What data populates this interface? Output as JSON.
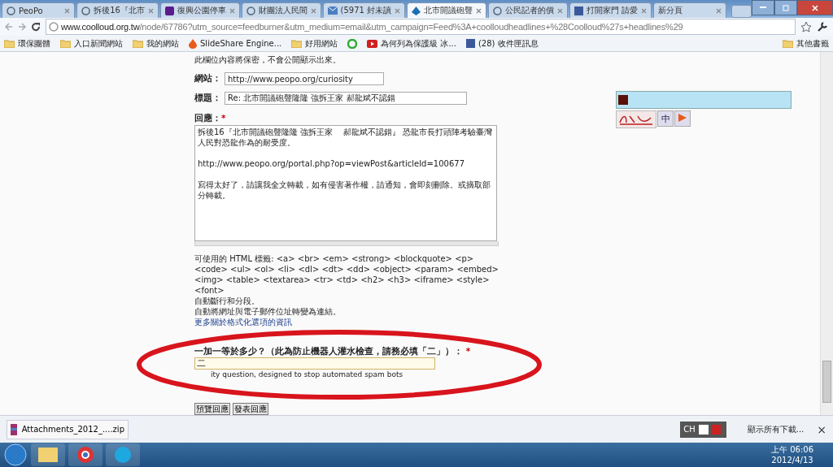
{
  "tabs": [
    {
      "title": "PeoPo",
      "kind": "globe",
      "selected": false
    },
    {
      "title": "拆後16『北市",
      "kind": "globe",
      "selected": false
    },
    {
      "title": "復興公園停車",
      "kind": "yahoo",
      "selected": false
    },
    {
      "title": "財團法人民間",
      "kind": "globe",
      "selected": false
    },
    {
      "title": "(5971 封未讀",
      "kind": "mail",
      "selected": false
    },
    {
      "title": "北市開議砲聲",
      "kind": "site",
      "selected": true
    },
    {
      "title": "公民記者的價",
      "kind": "globe",
      "selected": false
    },
    {
      "title": "打開家門 請愛",
      "kind": "facebook",
      "selected": false
    },
    {
      "title": "新分頁",
      "kind": "blank",
      "selected": false
    }
  ],
  "address_bar": {
    "domain": "www.coolloud.org.tw",
    "path": "/node/67786?utm_source=feedburner&utm_medium=email&utm_campaign=Feed%3A+coolloudheadlines+%28Coolloud%27s+headlines%29"
  },
  "bookmarks": [
    {
      "label": "環保團體",
      "kind": "folder"
    },
    {
      "label": "入口新聞網站",
      "kind": "folder"
    },
    {
      "label": "我的網站",
      "kind": "folder"
    },
    {
      "label": "SlideShare Engine...",
      "kind": "flame"
    },
    {
      "label": "好用網站",
      "kind": "folder"
    },
    {
      "label": "為何列為保護級 冰...",
      "kind": "video"
    },
    {
      "label": "(28) 收件匣訊息",
      "kind": "facebook"
    }
  ],
  "other_bookmarks": "其他書籤",
  "form": {
    "privacy_note": "此欄位內容將保密，不會公開顯示出來。",
    "website": {
      "label": "網站：",
      "value": "http://www.peopo.org/curiosity"
    },
    "subject": {
      "label": "標題：",
      "value": "Re: 北市開議砲聲隆隆  強拆王家    郝龍斌不認錯"
    },
    "comment": {
      "label": "回應：",
      "required_mark": "*",
      "value": "拆後16『北市開議砲聲隆隆 強拆王家    郝龍斌不認錯』 恐龍市長打頭陣考驗臺灣人民對恐龍作為的耐受度。\n\nhttp://www.peopo.org/portal.php?op=viewPost&articleId=100677\n\n寫得太好了，請讓我全文轉載，如有侵害著作權，請通知，會即刻刪除。或摘取部分轉載。"
    },
    "format_tips": [
      "可使用的 HTML 標籤: <a> <br> <em> <strong> <blockquote> <p> <code> <ul> <ol> <li> <dl> <dt> <dd> <object> <param> <embed> <img> <table> <textarea> <tr> <td> <h2> <h3> <iframe> <style><font>",
      "自動斷行和分段。",
      "自動將網址與電子郵件位址轉變為連結。"
    ],
    "more_link": "更多關於格式化選項的資訊",
    "captcha": {
      "label": "一加一等於多少？（此為防止機器人灌水檢查，請務必填「二」）：",
      "required_mark": "*",
      "value": "二",
      "hint": "ity question, designed to stop automated spam bots"
    },
    "buttons": [
      "預覽回應",
      "發表回應"
    ]
  },
  "widget": {
    "lang_button": "中"
  },
  "download_bar": {
    "file": "Attachments_2012_....zip",
    "show_all": "顯示所有下載...",
    "close": "×"
  },
  "tray": {
    "ime": "CH",
    "time": "上午 06:06",
    "date": "2012/4/13"
  }
}
